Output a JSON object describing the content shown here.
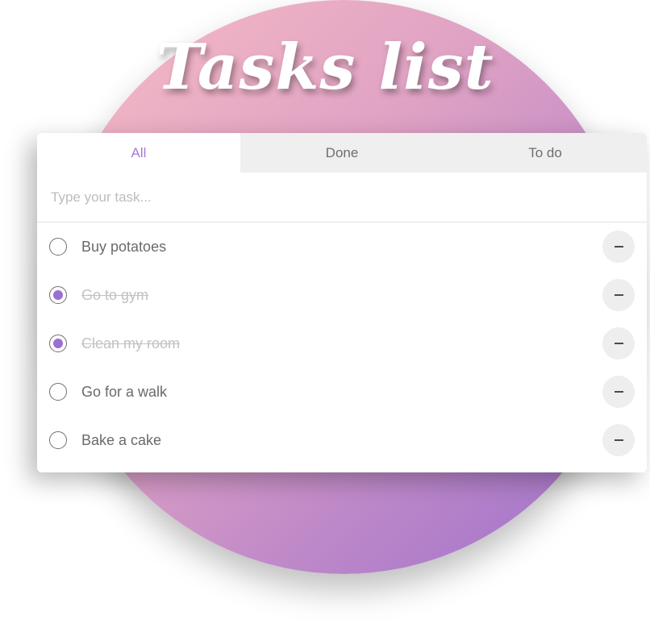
{
  "app": {
    "title": "Tasks list"
  },
  "tabs": [
    {
      "label": "All",
      "active": true
    },
    {
      "label": "Done",
      "active": false
    },
    {
      "label": "To do",
      "active": false
    }
  ],
  "input": {
    "placeholder": "Type your task...",
    "value": ""
  },
  "tasks": [
    {
      "label": "Buy potatoes",
      "done": false
    },
    {
      "label": "Go to gym",
      "done": true
    },
    {
      "label": "Clean my room",
      "done": true
    },
    {
      "label": "Go for a walk",
      "done": false
    },
    {
      "label": "Bake a cake",
      "done": false
    }
  ],
  "colors": {
    "accent": "#9b6fd3",
    "gradient_start": "#f8bcc5",
    "gradient_end": "#9c6fcb"
  },
  "icons": {
    "remove": "minus-icon"
  }
}
